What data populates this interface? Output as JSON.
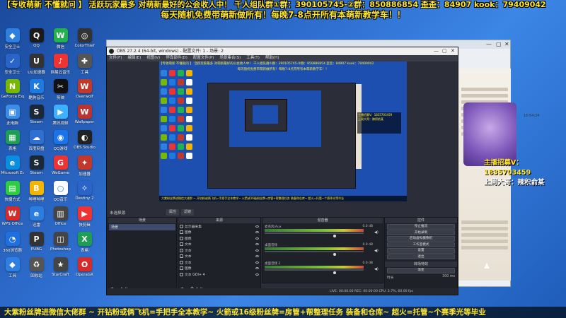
{
  "banners": {
    "top": "【专收萌新 不懂就问 】 活跃玩家最多 对萌新最好的公会收人中！ 千人组队群①群：390105745-②群：850886854 歪歪：84907 kook：79409042",
    "sub": "每天随机免费带萌新做所有！每晚7-8点开所有本萌新教学车！！",
    "bottom": "大紫粉丝牌进微信大佬群 ~ 开钻粉或俩飞机=手把手全本教学~ 火箭或16级粉丝牌=房管+帮整理任务 装备和仓库~ 超火=托管~个赛季光等毕业"
  },
  "desktop_icons": [
    {
      "label": "安全卫士",
      "icon": "shield-icon",
      "color": "#2d7fe0",
      "glyph": "◆"
    },
    {
      "label": "QQ",
      "icon": "qq-icon",
      "color": "#1a1a1a",
      "glyph": "Q"
    },
    {
      "label": "微信",
      "icon": "wechat-icon",
      "color": "#22b14c",
      "glyph": "W"
    },
    {
      "label": "ColorThief",
      "icon": "app-icon",
      "color": "#333333",
      "glyph": "◎"
    },
    {
      "label": "安全卫士",
      "icon": "security-icon",
      "color": "#2b64c8",
      "glyph": "✓"
    },
    {
      "label": "UU加速器",
      "icon": "accelerator-icon",
      "color": "#333333",
      "glyph": "U"
    },
    {
      "label": "网易云音乐",
      "icon": "music-icon",
      "color": "#e33",
      "glyph": "♪"
    },
    {
      "label": "工具",
      "icon": "tool-icon",
      "color": "#555",
      "glyph": "✚"
    },
    {
      "label": "GeForce Experience",
      "icon": "nvidia-icon",
      "color": "#76b900",
      "glyph": "N"
    },
    {
      "label": "酷狗音乐",
      "icon": "kugou-icon",
      "color": "#1f7ae0",
      "glyph": "K"
    },
    {
      "label": "剪映",
      "icon": "capcut-icon",
      "color": "#111",
      "glyph": "✂"
    },
    {
      "label": "Overwolf",
      "icon": "overwolf-icon",
      "color": "#c0392b",
      "glyph": "W"
    },
    {
      "label": "此电脑",
      "icon": "computer-icon",
      "color": "#3a8ee6",
      "glyph": "▣"
    },
    {
      "label": "Steam",
      "icon": "steam-icon",
      "color": "#1b2838",
      "glyph": "S"
    },
    {
      "label": "腾讯视频",
      "icon": "video-icon",
      "color": "#3db0ff",
      "glyph": "▶"
    },
    {
      "label": "Wallpaper",
      "icon": "wallpaper-icon",
      "color": "#b33",
      "glyph": "W"
    },
    {
      "label": "表格",
      "icon": "sheet-icon",
      "color": "#1f9d55",
      "glyph": "▦"
    },
    {
      "label": "百度网盘",
      "icon": "cloud-icon",
      "color": "#2f6fd0",
      "glyph": "☁"
    },
    {
      "label": "QQ游戏",
      "icon": "game-icon",
      "color": "#1a73e8",
      "glyph": "◉"
    },
    {
      "label": "OBS Studio",
      "icon": "obs-icon",
      "color": "#222",
      "glyph": "◐"
    },
    {
      "label": "Microsoft Edge",
      "icon": "edge-icon",
      "color": "#0c8ee0",
      "glyph": "e"
    },
    {
      "label": "Steam",
      "icon": "steam-icon",
      "color": "#1b2838",
      "glyph": "S"
    },
    {
      "label": "WeGame",
      "icon": "wegame-icon",
      "color": "#e33",
      "glyph": "G"
    },
    {
      "label": "加速器",
      "icon": "booster-icon",
      "color": "#c0392b",
      "glyph": "✦"
    },
    {
      "label": "快捷方式",
      "icon": "shortcut-icon",
      "color": "#2ecc40",
      "glyph": "▤"
    },
    {
      "label": "哔哩哔哩",
      "icon": "bilibili-icon",
      "color": "#f5b400",
      "glyph": "B"
    },
    {
      "label": "QQ音乐",
      "icon": "qqmusic-icon",
      "color": "#fff",
      "glyph": "○"
    },
    {
      "label": "Destiny 2",
      "icon": "destiny-icon",
      "color": "#2b64c8",
      "glyph": "✧"
    },
    {
      "label": "WPS Office",
      "icon": "wps-icon",
      "color": "#d62b2b",
      "glyph": "W"
    },
    {
      "label": "迅雷",
      "icon": "thunder-icon",
      "color": "#2b7de0",
      "glyph": "e"
    },
    {
      "label": "Office",
      "icon": "office-icon",
      "color": "#444",
      "glyph": "▥"
    },
    {
      "label": "快剪辑",
      "icon": "edit-icon",
      "color": "#e33",
      "glyph": "▶"
    },
    {
      "label": "360浏览器",
      "icon": "browser-icon",
      "color": "#1f6fe0",
      "glyph": "◔"
    },
    {
      "label": "PUBG",
      "icon": "pubg-icon",
      "color": "#333",
      "glyph": "P"
    },
    {
      "label": "Photoshop",
      "icon": "photoshop-icon",
      "color": "#444",
      "glyph": "◫"
    },
    {
      "label": "表格",
      "icon": "excel-icon",
      "color": "#1f9d55",
      "glyph": "X"
    },
    {
      "label": "工具",
      "icon": "tool-icon",
      "color": "#2d7fe0",
      "glyph": "◆"
    },
    {
      "label": "回收站",
      "icon": "recycle-icon",
      "color": "#555",
      "glyph": "♻"
    },
    {
      "label": "StarCraft",
      "icon": "star-icon",
      "color": "#444",
      "glyph": "★"
    },
    {
      "label": "OperaGX",
      "icon": "opera-icon",
      "color": "#d62b2b",
      "glyph": "O"
    }
  ],
  "obs": {
    "title": "OBS 27.2.4 (64-bit, windows) - 配置文件: 1 - 场景: 2",
    "menu": [
      "文件(F)",
      "编辑(E)",
      "视图(V)",
      "停靠部件(D)",
      "配置文件(P)",
      "场景集合(S)",
      "工具(T)",
      "帮助(H)"
    ],
    "no_source_label": "未选择源",
    "tabs": [
      "属性",
      "滤镜"
    ],
    "scenes_header": "场景",
    "scene_name": "场景",
    "sources_header": "来源",
    "sources": [
      "显示器采集",
      "图像",
      "图像",
      "文本",
      "文本",
      "文本",
      "文本",
      "图像",
      "文本 GDI+ 4"
    ],
    "mixer_header": "混音器",
    "mixer_rows": [
      {
        "label": "麦克风/Aux",
        "db": "0.0 dB"
      },
      {
        "label": "桌面音频",
        "db": "0.0 dB"
      },
      {
        "label": "桌面音频 2",
        "db": "0.0 dB"
      }
    ],
    "controls_header": "控件",
    "controls": [
      "停止推流",
      "开始录制",
      "启动虚拟摄像机",
      "工作室模式",
      "设置",
      "退出"
    ],
    "transitions_header": "转场特效",
    "transition_name": "渐变",
    "duration_label": "时长",
    "duration_value": "300 ms",
    "status": "LIVE: 00:00:00   REC: 00:00:00   CPU: 3.7%, 60.00 fps"
  },
  "preview": {
    "banner": "【专收萌新 不懂就问 】 活跃玩家最多 对萌新最好的公会收人中！ 千人组队群①群：390105745-②群：850886854 歪歪：84907 kook：79409042",
    "sub": "每天随机免费带萌新做所有！每晚7-8点开所有本萌新教学车！！",
    "badge_line1": "主播招募V：1835703459",
    "badge_line2": "上周大哥：辣积俞某",
    "bottom": "大紫粉丝牌进微信大佬群 ~ 开钻粉或俩飞机=手把手全本教学~ 火箭或16级粉丝牌=房管+帮整理任务 装备和仓库~ 超火=托管~个赛季光等毕业"
  },
  "overlay": {
    "recruit": "主播招募V：1835703459",
    "last_week": "上周大哥：辣积俞某",
    "time": "15:54:24"
  }
}
